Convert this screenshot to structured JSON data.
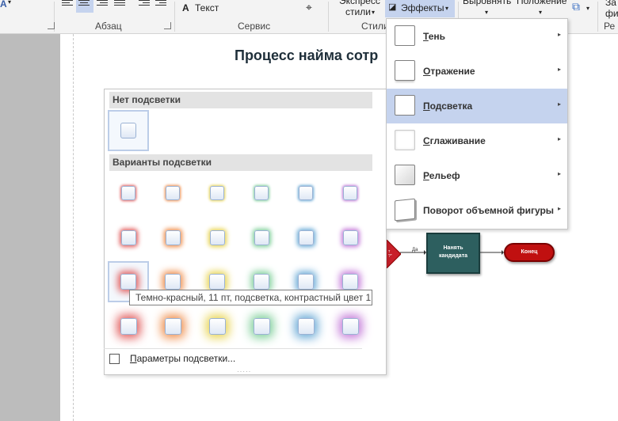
{
  "ribbon": {
    "paragraph_label": "Абзац",
    "service_label": "Сервис",
    "styles_label": "Стили",
    "text_button": "Текст",
    "text_icon": "letter-a-icon",
    "express_styles_line1": "Экспресс",
    "express_styles_line2": "стили",
    "effects_button": "Эффекты",
    "align_label": "Выровнять",
    "position_label": "Положение",
    "truncated_left": "A",
    "truncated_right_top": "За",
    "truncated_right_bottom": "фи",
    "truncated_right_label": "Ре"
  },
  "document": {
    "title": "Процесс найма сотр",
    "flow_yes_label": "Да",
    "hire_box_line1": "Нанять",
    "hire_box_line2": "кандидата",
    "end_label": "Конец"
  },
  "effects_menu": {
    "items": [
      {
        "label": "Тень",
        "underline": "Т",
        "rest": "ень"
      },
      {
        "label": "Отражение",
        "underline": "О",
        "rest": "тражение"
      },
      {
        "label": "Подсветка",
        "underline": "П",
        "rest": "одсветка"
      },
      {
        "label": "Сглаживание",
        "underline": "С",
        "rest": "глаживание"
      },
      {
        "label": "Рельеф",
        "underline": "Р",
        "rest": "ельеф"
      },
      {
        "label": "Поворот объемной фигуры",
        "underline": "",
        "rest": "Поворот объемной фигуры"
      }
    ],
    "highlighted_index": 2
  },
  "glow_gallery": {
    "no_glow_header": "Нет подсветки",
    "variants_header": "Варианты подсветки",
    "glow_colors": [
      "#e05a5a",
      "#ef8d4a",
      "#e8d452",
      "#7fcf9a",
      "#6aaad6",
      "#c47ad8"
    ],
    "rows": 4,
    "tooltip": "Темно-красный, 11 пт, подсветка, контрастный цвет 1",
    "options_link": "Параметры подсветки...",
    "options_underline": "П",
    "options_rest": "араметры подсветки..."
  }
}
